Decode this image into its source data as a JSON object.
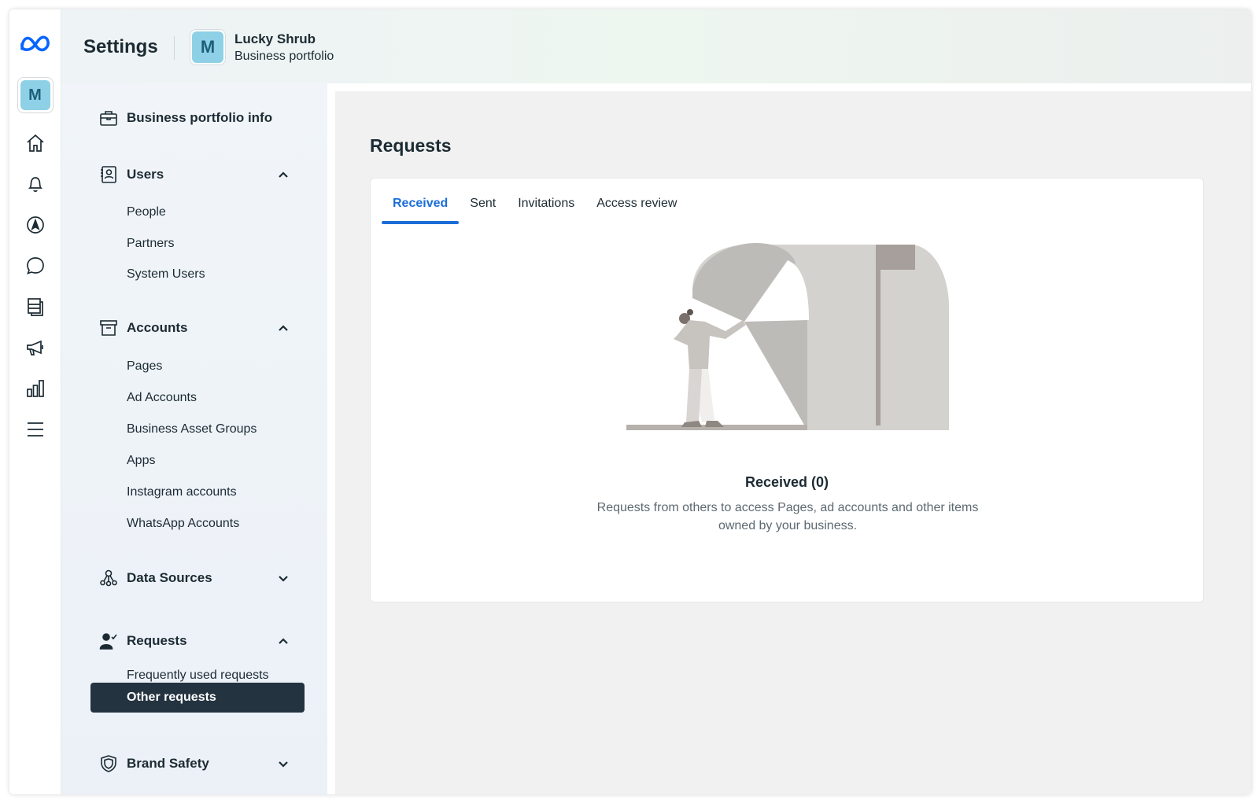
{
  "header": {
    "title": "Settings",
    "business_initial": "M",
    "business_name": "Lucky Shrub",
    "business_type": "Business portfolio"
  },
  "rail": {
    "avatar_initial": "M",
    "icons": [
      "meta-logo",
      "home-icon",
      "bell-icon",
      "compass-icon",
      "chat-icon",
      "pages-icon",
      "megaphone-icon",
      "bar-chart-icon",
      "menu-icon"
    ]
  },
  "nav": {
    "business_info": "Business portfolio info",
    "users": {
      "label": "Users",
      "items": [
        "People",
        "Partners",
        "System Users"
      ]
    },
    "accounts": {
      "label": "Accounts",
      "items": [
        "Pages",
        "Ad Accounts",
        "Business Asset Groups",
        "Apps",
        "Instagram accounts",
        "WhatsApp Accounts"
      ]
    },
    "data_sources": {
      "label": "Data Sources"
    },
    "requests": {
      "label": "Requests",
      "items": [
        "Frequently used requests",
        "Other requests"
      ]
    },
    "brand_safety": {
      "label": "Brand Safety"
    }
  },
  "main": {
    "title": "Requests",
    "tabs": [
      "Received",
      "Sent",
      "Invitations",
      "Access review"
    ],
    "active_tab": "Received",
    "empty_title": "Received (0)",
    "empty_description": "Requests from others to access Pages, ad accounts and other items owned by your business."
  },
  "colors": {
    "accent": "#1a6ed8",
    "active_nav": "#243340",
    "avatar": "#8ed1e6"
  }
}
